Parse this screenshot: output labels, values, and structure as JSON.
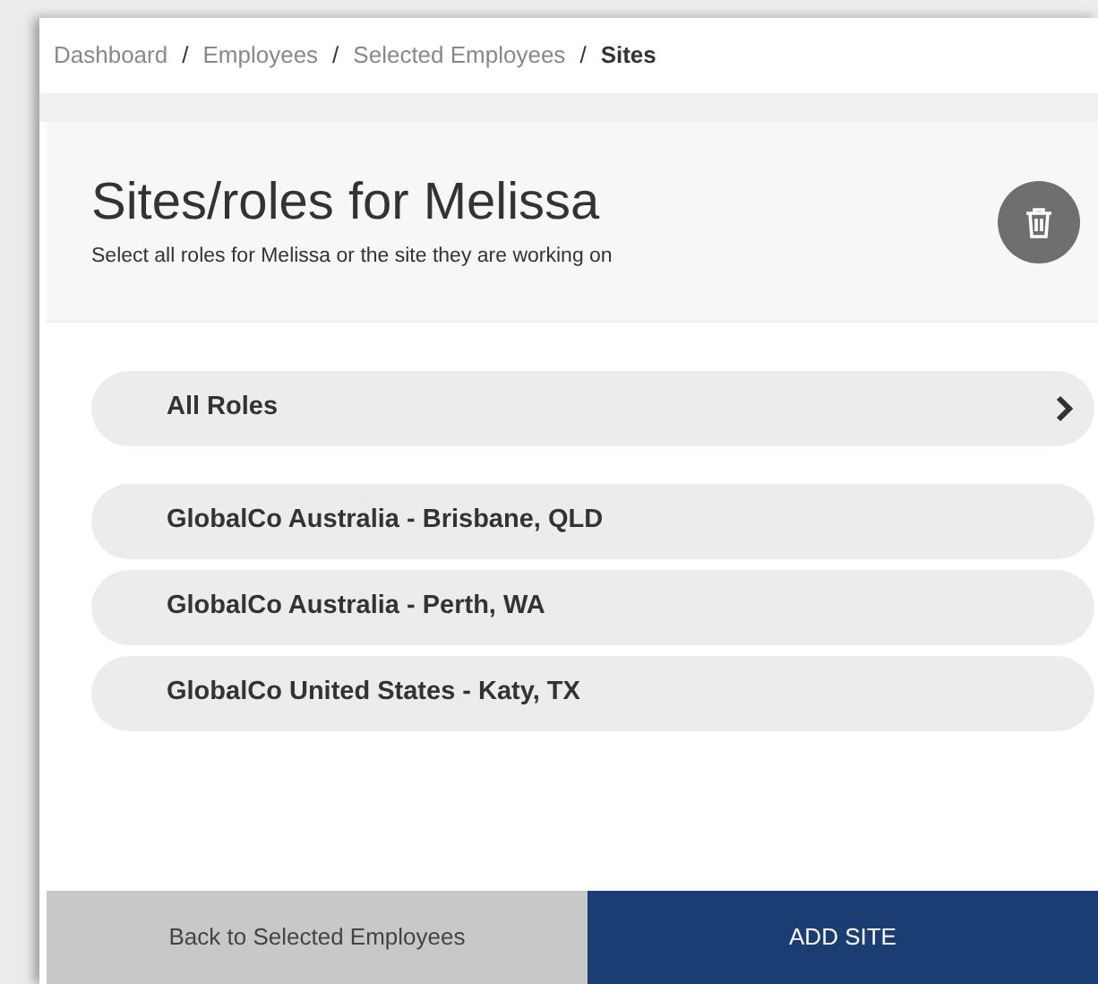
{
  "breadcrumbs": [
    {
      "label": "Dashboard",
      "current": false
    },
    {
      "separator": "/",
      "label": "Employees",
      "current": false
    },
    {
      "separator": "/",
      "label": "Selected Employees",
      "current": false
    },
    {
      "separator": "/",
      "label": "Sites",
      "current": true
    }
  ],
  "header": {
    "title": "Sites/roles for Melissa",
    "subtitle": "Select all roles for Melissa or the site they are working on"
  },
  "items": [
    {
      "label": "All Roles",
      "kind": "navigate"
    },
    {
      "label": "GlobalCo Australia - Brisbane, QLD",
      "kind": "site"
    },
    {
      "label": "GlobalCo Australia - Perth, WA",
      "kind": "site"
    },
    {
      "label": "GlobalCo United States - Katy, TX",
      "kind": "site"
    }
  ],
  "footer": {
    "back": "Back to Selected Employees",
    "primary": "ADD SITE"
  }
}
